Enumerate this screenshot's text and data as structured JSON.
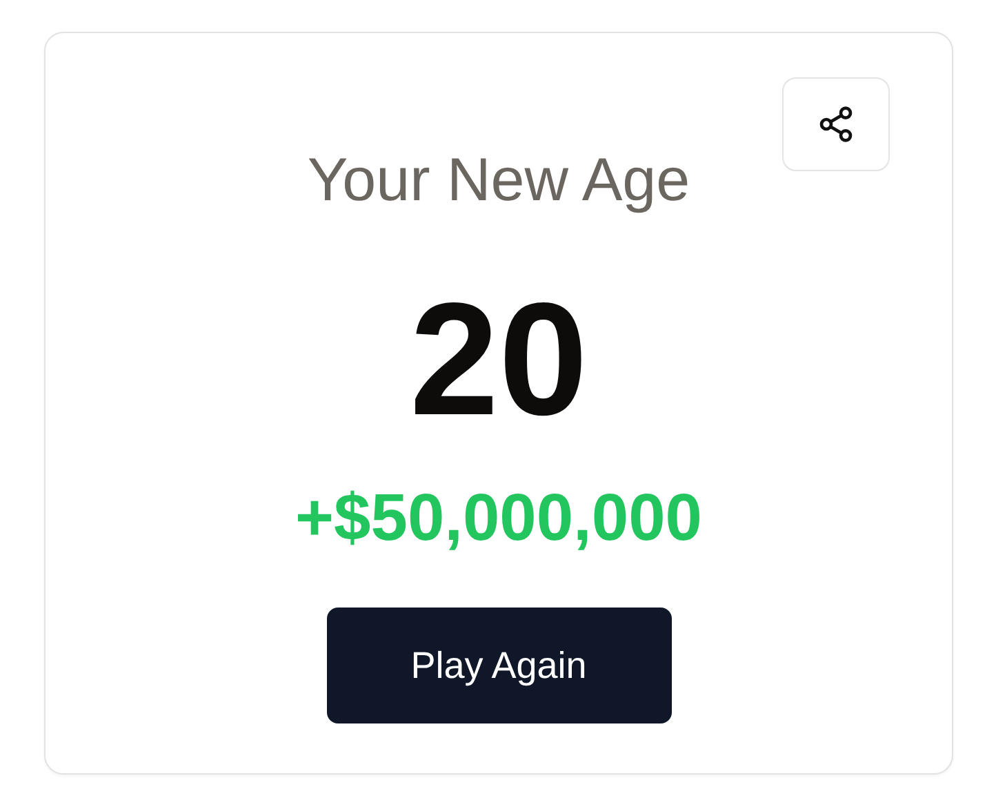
{
  "title": "Your New Age",
  "age": "20",
  "reward": "+$50,000,000",
  "button": "Play Again"
}
